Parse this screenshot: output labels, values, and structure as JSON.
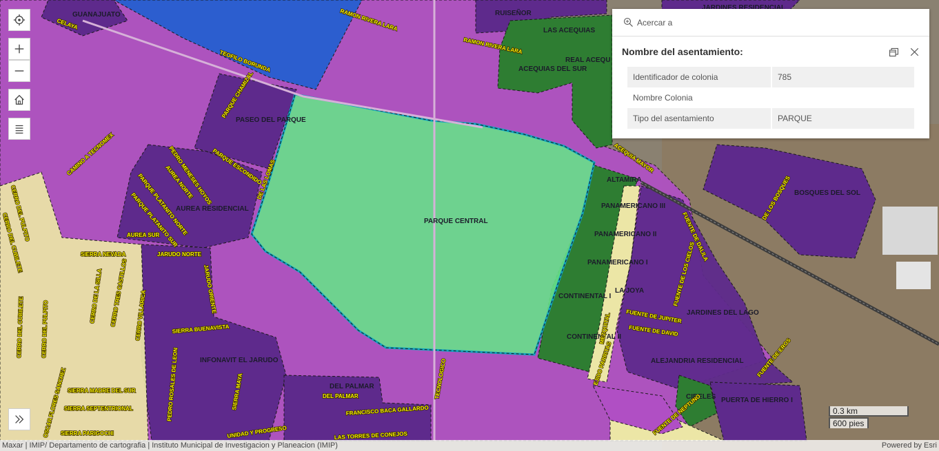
{
  "map": {
    "labels": {
      "guanajuato": "GUANAJUATO",
      "celaya": "CELAYA",
      "ruisenor": "RUISEÑOR",
      "las_acequias": "LAS ACEQUIAS",
      "real_acequ": "REAL ACEQU",
      "acequias_del_sur": "ACEQUIAS DEL SUR",
      "jardines_residencial": "JARDINES RESIDENCIAL",
      "paseo_del_parque": "PASEO DEL PARQUE",
      "parque_central": "PARQUE CENTRAL",
      "aurea_residencial": "AUREA RESIDENCIAL",
      "altamira": "ALTAMIRA",
      "panamericano_iii": "PANAMERICANO III",
      "panamericano_ii": "PANAMERICANO II",
      "panamericano_i": "PANAMERICANO I",
      "continental_i": "CONTINENTAL I",
      "la_joya": "LA JOYA",
      "continental_ii": "CONTINENTAL II",
      "bosques_del_sol": "BOSQUES DEL SOL",
      "jardines_del_lago": "JARDINES DEL LAGO",
      "alejandria_residencial": "ALEJANDRIA RESIDENCIAL",
      "cibeles": "CIBELES",
      "puerta_de_hierro_i": "PUERTA DE HIERRO I",
      "infonavit_el_jarudo": "INFONAVIT EL JARUDO",
      "del_palmar": "DEL PALMAR"
    },
    "streets": {
      "ramon_rivera_lara_1": "RAMON RIVERA LARA",
      "ramon_rivera_lara_2": "RAMON RIVERA LARA",
      "teofilo_borunda": "TEOFILO BORUNDA",
      "camino_a_tecnomex": "CAMINO A TECNOMEX",
      "parque_chamizal": "PARQUE CHAMIZAL",
      "parque_escondido": "PARQUE ESCONDIDO",
      "pedro_meneses_hoyos": "PEDRO MENESES HOYOS",
      "aurea_norte": "AUREA NORTE",
      "de_las_lomas": "DE LAS LOMAS",
      "parque_platanito_norte": "PARQUE PLATANITO NORTE",
      "parque_platanito_sur": "PARQUE PLATANITO SUR",
      "aurea_sur": "AUREA SUR",
      "cerro_del_pulpito_1": "CERRO DEL PULPITO",
      "cerro_del_cubilete_1": "CERRO DEL CUBILETE",
      "sierra_nevada": "SIERRA NEVADA",
      "jarudo_norte": "JARUDO NORTE",
      "cerro_de_la_silla": "CERRO DE LA SILLA",
      "cerro_tres_castillos": "CERRO TRES CASTILLOS",
      "cerro_villarica": "CERRO VILLARICA",
      "jarudo_oriente": "JARUDO ORIENTE",
      "sierra_buenavista": "SIERRA BUENAVISTA",
      "cerro_del_cubilete_2": "CERRO DEL CUBILETE",
      "cerro_del_pulpito_2": "CERRO DEL PULPITO",
      "sierra_madre_del_sur": "SIERRA MADRE DEL SUR",
      "sierra_septentrional": "SIERRA SEPTENTRIONAL",
      "sierra_parigochi": "SIERRA PARIGOCHI",
      "oscar_flores_sanchez": "OSCAR FLORES SANCHEZ",
      "sierra_maya": "SIERRA MAYA",
      "unidad_y_progreso": "UNIDAD Y PROGRESO",
      "francisco_baca_gallardo": "FRANCISCO BACA GALLARDO",
      "del_palmar_street": "DEL PALMAR",
      "tecnologico": "TECNOLOGICO",
      "acequia_mayor": "ACEQUIA MAYOR",
      "fuente_de_dalila": "FUENTE DE DALILA",
      "fuente_de_los_cielos": "FUENTE DE LOS CIELOS",
      "fuente_de_jupiter": "FUENTE DE JUPITER",
      "fuente_de_david": "FUENTE DE DAVID",
      "fuente_de_eros": "FUENTE DE EROS",
      "de_los_bosques": "DE LOS BOSQUES",
      "ejido_parritas": "EJIDO PARRITAS",
      "mezquital": "MEZQUITAL",
      "fuente_de_neptuno": "FUENTE DE NEPTUNO",
      "pedro_rosales_de_leon": "PEDRO ROSALES DE LEON",
      "las_torres_de_conejos": "LAS TORRES DE CONEJOS"
    }
  },
  "popup": {
    "zoom_label": "Acercar a",
    "title": "Nombre del asentamiento:",
    "rows": [
      {
        "key": "Identificador de colonia",
        "value": "785"
      },
      {
        "key": "Nombre Colonia",
        "value": ""
      },
      {
        "key": "Tipo del asentamiento",
        "value": "PARQUE"
      }
    ]
  },
  "scalebar": {
    "km": "0.3 km",
    "pies": "600 pies"
  },
  "attribution": {
    "left": "Maxar | IMIP/ Departamento de cartografia | Instituto Municipal de Investigacion y Planeacion (IMIP)",
    "right": "Powered by Esri"
  },
  "colors": {
    "magenta": "#b04fc4",
    "purple_dark": "#5e2a8c",
    "blue": "#1e5fd0",
    "green_dark": "#2e7d32",
    "park_green": "#67e08a",
    "pale_yellow": "#ece6a6"
  }
}
